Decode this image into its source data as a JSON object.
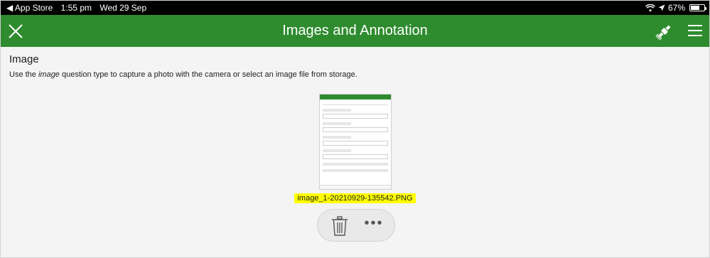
{
  "status_bar": {
    "back_app": "◀ App Store",
    "time": "1:55 pm",
    "date": "Wed 29 Sep",
    "battery_percent": "67%",
    "battery_level": 0.67
  },
  "header": {
    "title": "Images and Annotation",
    "background_color": "#2e8b2e"
  },
  "question": {
    "title": "Image",
    "hint_prefix": "Use the ",
    "hint_emphasis": "image",
    "hint_suffix": " question type to capture a photo with the camera or select an image file from storage."
  },
  "attachment": {
    "filename": "image_1-20210929-135542.PNG",
    "highlight_color": "#ffff00"
  },
  "actions": {
    "more_label": "•••"
  },
  "icons": {
    "close": "close-icon",
    "gps": "gps-satellite-icon",
    "menu": "hamburger-menu-icon",
    "trash": "trash-icon",
    "more": "more-horizontal-icon"
  }
}
